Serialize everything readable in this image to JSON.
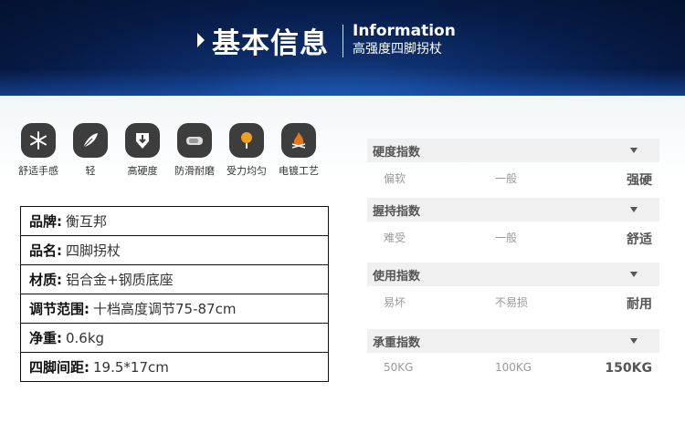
{
  "header": {
    "title_cn": "基本信息",
    "title_en": "Information",
    "subtitle": "高强度四脚拐杖"
  },
  "features": [
    {
      "icon": "snowflake-icon",
      "label": "舒适手感"
    },
    {
      "icon": "feather-icon",
      "label": "轻"
    },
    {
      "icon": "shield-down-icon",
      "label": "高硬度"
    },
    {
      "icon": "rubber-tip-icon",
      "label": "防滑耐磨"
    },
    {
      "icon": "balanced-force-icon",
      "label": "受力均匀"
    },
    {
      "icon": "flame-icon",
      "label": "电镀工艺"
    }
  ],
  "specs": [
    {
      "key": "品牌:",
      "value": "衡互邦"
    },
    {
      "key": "品名:",
      "value": "四脚拐杖"
    },
    {
      "key": "材质:",
      "value": "铝合金+钢质底座"
    },
    {
      "key": "调节范围:",
      "value": "十档高度调节75-87cm"
    },
    {
      "key": "净重:",
      "value": "0.6kg"
    },
    {
      "key": "四脚间距:",
      "value": "19.5*17cm"
    }
  ],
  "metrics": [
    {
      "title": "硬度指数",
      "scale": [
        "偏软",
        "一般",
        "强硬"
      ],
      "selected": "强硬"
    },
    {
      "title": "握持指数",
      "scale": [
        "难受",
        "一般",
        "舒适"
      ],
      "selected": "舒适"
    },
    {
      "title": "使用指数",
      "scale": [
        "易坏",
        "不易损",
        "耐用"
      ],
      "selected": "耐用"
    },
    {
      "title": "承重指数",
      "scale": [
        "50KG",
        "100KG",
        "150KG"
      ],
      "selected": "150KG"
    }
  ],
  "colors": {
    "header_dark": "#061a44",
    "header_accent": "#1f5fb4",
    "icon_bg": "#3d3d3d",
    "metric_header_bg": "#f0f0f0"
  }
}
